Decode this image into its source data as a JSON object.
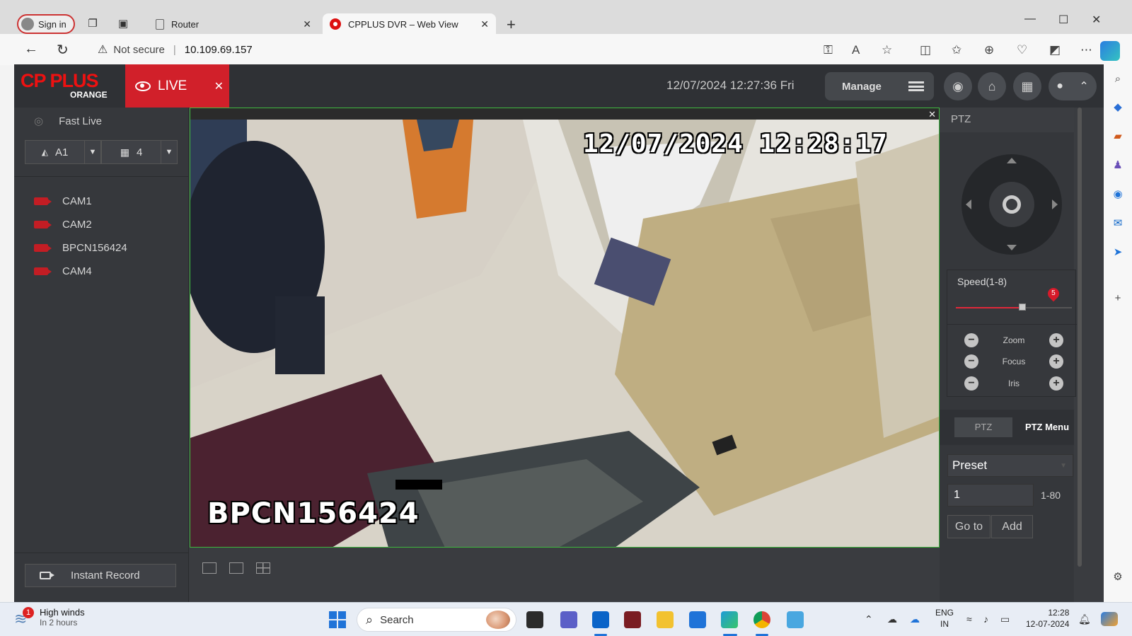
{
  "browser": {
    "signin_label": "Sign in",
    "tabs": [
      {
        "title": "Router",
        "active": false
      },
      {
        "title": "CPPLUS DVR – Web View",
        "active": true
      }
    ],
    "address": {
      "security_label": "Not secure",
      "url": "10.109.69.157"
    }
  },
  "dvr": {
    "logo": {
      "brand": "CP PLUS",
      "sub": "ORANGE"
    },
    "live_tab_label": "LIVE",
    "datetime": "12/07/2024 12:27:36 Fri",
    "manage_label": "Manage",
    "left_panel": {
      "fast_live_label": "Fast Live",
      "channel_select": "A1",
      "layout_select": "4",
      "cameras": [
        "CAM1",
        "CAM2",
        "BPCN156424",
        "CAM4"
      ],
      "instant_record_label": "Instant Record"
    },
    "video": {
      "osd_timestamp": "12/07/2024 12:28:17",
      "osd_channel_name": "BPCN156424"
    },
    "ptz": {
      "header": "PTZ",
      "speed_label": "Speed(1-8)",
      "speed_value": "5",
      "speed_max": 8,
      "controls": [
        "Zoom",
        "Focus",
        "Iris"
      ],
      "tabs": [
        "PTZ",
        "PTZ Menu"
      ],
      "preset_label": "Preset",
      "preset_value": "1",
      "preset_range": "1-80",
      "goto_label": "Go to",
      "add_label": "Add"
    }
  },
  "taskbar": {
    "weather_title": "High winds",
    "weather_sub": "In 2 hours",
    "weather_badge": "1",
    "search_placeholder": "Search",
    "lang_line1": "ENG",
    "lang_line2": "IN",
    "time": "12:28",
    "date": "12-07-2024"
  },
  "colors": {
    "accent_red": "#d1202a",
    "live_border_green": "#3fb83f",
    "app_background": "#3a3c40"
  }
}
